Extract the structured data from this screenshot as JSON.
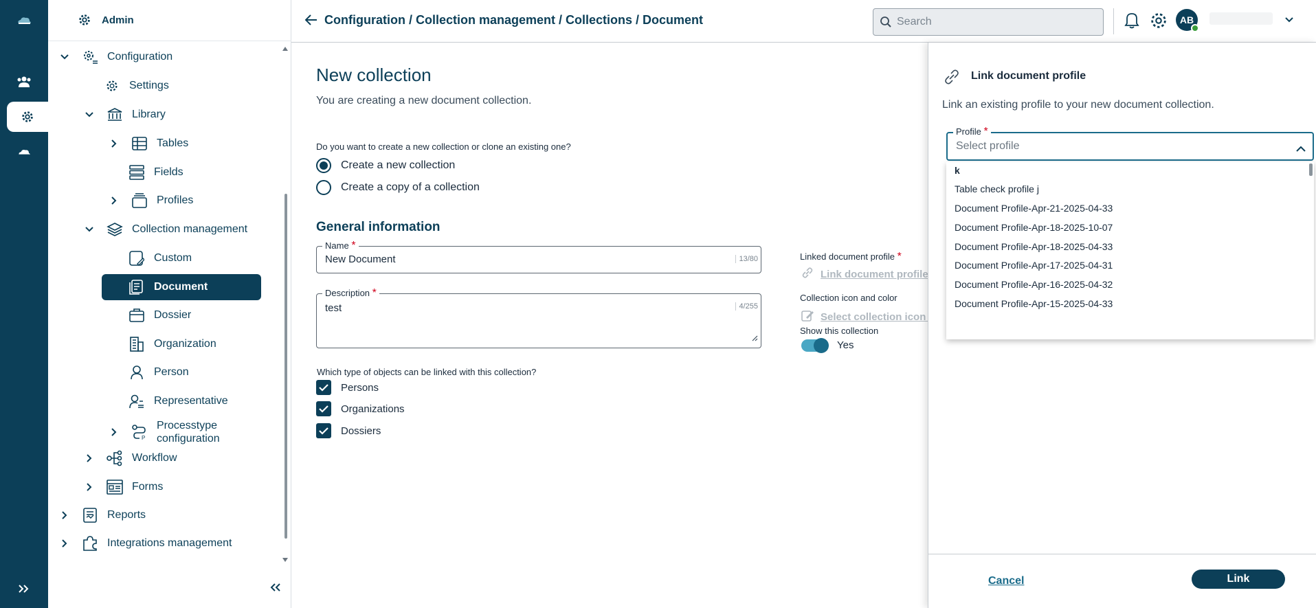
{
  "colors": {
    "primary": "#0c3f58",
    "accent": "#1a6b8a",
    "required": "#d0021b"
  },
  "rail": {
    "items": [
      {
        "icon": "cloud-logo-icon"
      },
      {
        "icon": "team-icon"
      },
      {
        "icon": "gear-icon"
      },
      {
        "icon": "cloud-icon"
      },
      {
        "icon": "expand-rail-icon"
      }
    ]
  },
  "sidebar": {
    "header": "Admin",
    "items": {
      "configuration": "Configuration",
      "settings": "Settings",
      "library": "Library",
      "tables": "Tables",
      "fields": "Fields",
      "profiles": "Profiles",
      "collection_management": "Collection management",
      "custom": "Custom",
      "document": "Document",
      "dossier": "Dossier",
      "organization": "Organization",
      "person": "Person",
      "representative": "Representative",
      "processtype_line1": "Processtype",
      "processtype_line2": "configuration",
      "workflow": "Workflow",
      "forms": "Forms",
      "reports": "Reports",
      "integrations": "Integrations management"
    }
  },
  "topbar": {
    "breadcrumb": "Configuration / Collection management / Collections / Document",
    "search_placeholder": "Search",
    "avatar_initials": "AB"
  },
  "main": {
    "title": "New collection",
    "subtitle": "You are creating a new document collection.",
    "question": "Do you want to create a new collection or clone an existing one?",
    "radio_new": "Create a new collection",
    "radio_copy": "Create a copy of a collection",
    "section_title": "General information",
    "name_label": "Name",
    "name_value": "New Document",
    "name_count": "13/80",
    "description_label": "Description",
    "description_value": "test",
    "description_count": "4/255",
    "linked_profile_label": "Linked document profile",
    "linked_profile_link": "Link document profile",
    "icon_color_label": "Collection icon and color",
    "icon_color_link": "Select collection icon a",
    "show_label": "Show this collection",
    "show_value": "Yes",
    "objects_question": "Which type of objects can be linked with this collection?",
    "check_persons": "Persons",
    "check_organizations": "Organizations",
    "check_dossiers": "Dossiers"
  },
  "panel": {
    "title": "Link document profile",
    "subtitle": "Link an existing profile to your new document collection.",
    "profile_label": "Profile",
    "profile_placeholder": "Select profile",
    "options": [
      "k",
      "Table check profile j",
      "Document Profile-Apr-21-2025-04-33",
      "Document Profile-Apr-18-2025-10-07",
      "Document Profile-Apr-18-2025-04-33",
      "Document Profile-Apr-17-2025-04-31",
      "Document Profile-Apr-16-2025-04-32",
      "Document Profile-Apr-15-2025-04-33"
    ],
    "cancel": "Cancel",
    "link": "Link"
  }
}
